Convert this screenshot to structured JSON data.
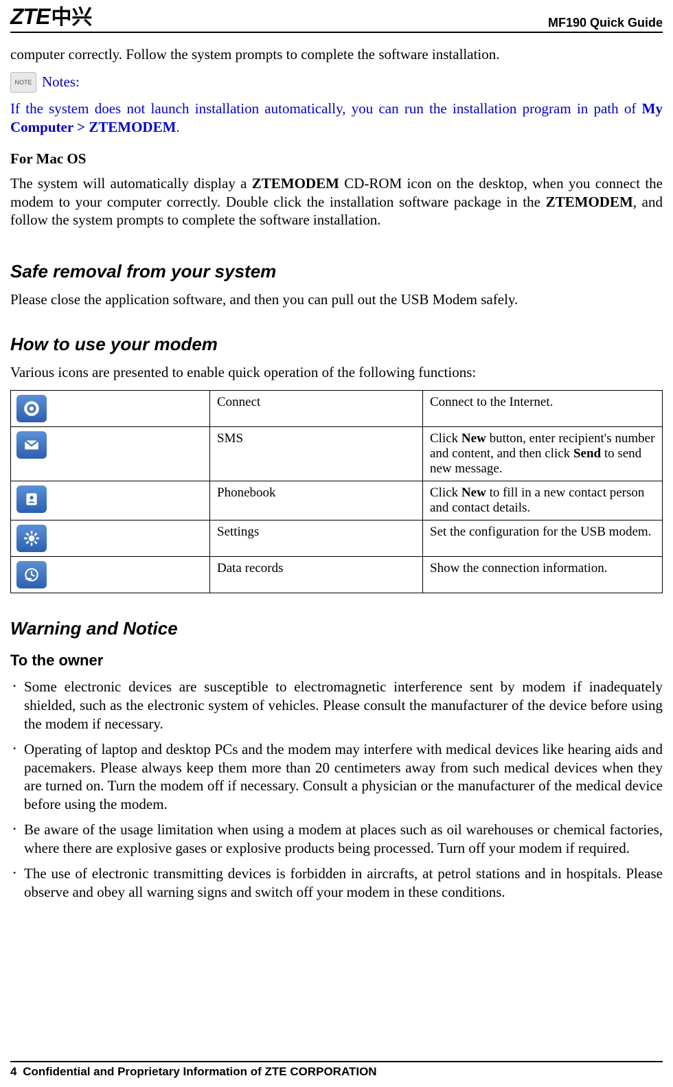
{
  "header": {
    "logo_text": "ZTE",
    "logo_cn": "中兴",
    "doc_title": "MF190 Quick Guide"
  },
  "intro_frag": "computer correctly. Follow the system prompts to complete the software installation.",
  "note_icon_label": "NOTE",
  "notes_label": "Notes:",
  "note_body_pre": "If the system does not launch installation automatically, you can run the installation program in path of ",
  "note_body_bold": "My Computer > ZTEMODEM",
  "note_body_post": ".",
  "mac_header": "For Mac OS",
  "mac_body_1": "The system will automatically display a ",
  "mac_body_bold1": "ZTEMODEM",
  "mac_body_2": " CD-ROM icon on the desktop, when you connect the modem to your computer correctly. Double click the installation software package in the ",
  "mac_body_bold2": "ZTEMODEM",
  "mac_body_3": ", and follow the system prompts to complete the software installation.",
  "section_safe": "Safe removal from your system",
  "safe_body": "Please close the application software, and then you can pull out the USB Modem safely.",
  "section_howto": "How to use your modem",
  "howto_intro": "Various icons are presented to enable quick operation of the following functions:",
  "table": {
    "rows": [
      {
        "name": "Connect",
        "desc_pre": "",
        "desc_bold1": "",
        "desc_mid": "Connect to the Internet.",
        "desc_bold2": "",
        "desc_post": ""
      },
      {
        "name": "SMS",
        "desc_pre": "Click ",
        "desc_bold1": "New",
        "desc_mid": " button, enter recipient's number and content, and then click ",
        "desc_bold2": "Send",
        "desc_post": " to send new message."
      },
      {
        "name": "Phonebook",
        "desc_pre": "Click ",
        "desc_bold1": "New",
        "desc_mid": " to fill in a new contact person and contact details.",
        "desc_bold2": "",
        "desc_post": ""
      },
      {
        "name": "Settings",
        "desc_pre": "",
        "desc_bold1": "",
        "desc_mid": "Set the configuration for the USB modem.",
        "desc_bold2": "",
        "desc_post": ""
      },
      {
        "name": "Data records",
        "desc_pre": "",
        "desc_bold1": "",
        "desc_mid": "Show the connection information.",
        "desc_bold2": "",
        "desc_post": ""
      }
    ]
  },
  "section_warning": "Warning and Notice",
  "subsection_owner": "To the owner",
  "owner_bullets": [
    "Some electronic devices are susceptible to electromagnetic interference sent by modem if inadequately shielded, such as the electronic system of vehicles. Please consult the manufacturer of the device before using the modem if necessary.",
    "Operating of laptop and desktop PCs and the modem may interfere with medical devices like hearing aids and pacemakers. Please always keep them more than 20 centimeters away from such medical devices when they are turned on. Turn the modem off if necessary. Consult a physician or the manufacturer of the medical device before using the modem.",
    "Be aware of the usage limitation when using a modem at places such as oil warehouses or chemical factories, where there are explosive gases or explosive products being processed. Turn off your modem if required.",
    "The use of electronic transmitting devices is forbidden in aircrafts, at petrol stations and in hospitals. Please observe and obey all warning signs and switch off your modem in these conditions."
  ],
  "footer": {
    "page": "4",
    "text": "Confidential and Proprietary Information of ZTE CORPORATION"
  }
}
